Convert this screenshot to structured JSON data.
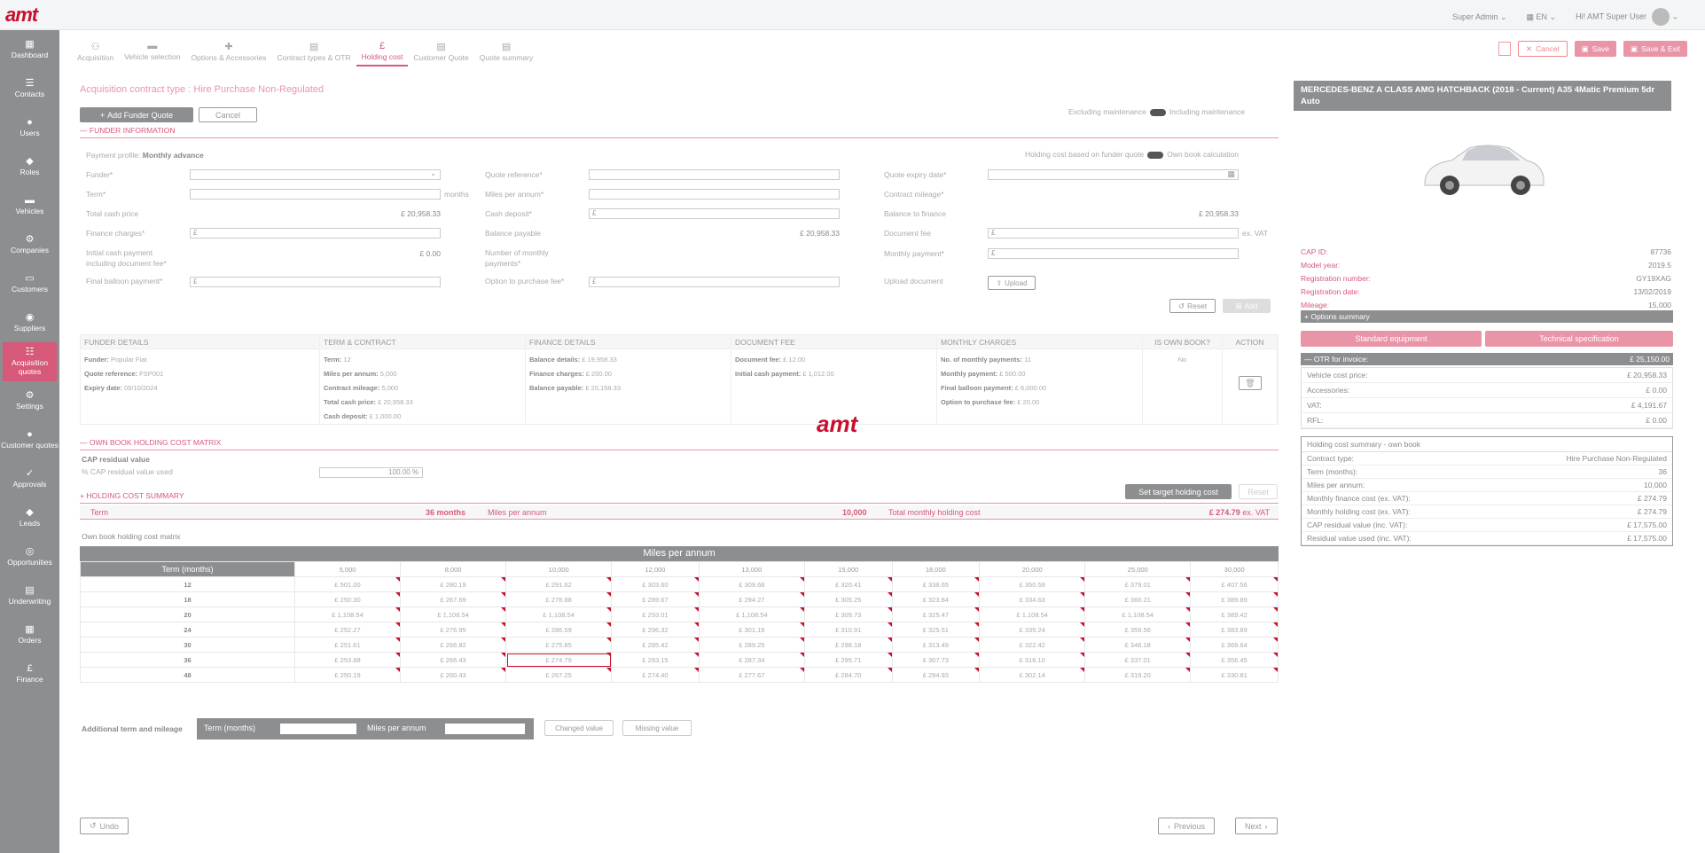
{
  "app": {
    "logo": "amt",
    "role": "Super Admin",
    "lang": "EN",
    "greeting": "Hi! AMT Super User",
    "watermark": "amt"
  },
  "sidebar": [
    {
      "icon": "▦",
      "label": "Dashboard"
    },
    {
      "icon": "☰",
      "label": "Contacts"
    },
    {
      "icon": "●",
      "label": "Users"
    },
    {
      "icon": "◆",
      "label": "Roles"
    },
    {
      "icon": "▬",
      "label": "Vehicles"
    },
    {
      "icon": "⚙",
      "label": "Companies"
    },
    {
      "icon": "▭",
      "label": "Customers"
    },
    {
      "icon": "◉",
      "label": "Suppliers"
    },
    {
      "icon": "☷",
      "label": "Acquisition quotes"
    },
    {
      "icon": "⚙",
      "label": "Settings"
    },
    {
      "icon": "●",
      "label": "Customer quotes"
    },
    {
      "icon": "✓",
      "label": "Approvals"
    },
    {
      "icon": "◆",
      "label": "Leads"
    },
    {
      "icon": "◎",
      "label": "Opportunities"
    },
    {
      "icon": "▤",
      "label": "Underwriting"
    },
    {
      "icon": "▦",
      "label": "Orders"
    },
    {
      "icon": "£",
      "label": "Finance"
    }
  ],
  "tabs": [
    {
      "icon": "⚇",
      "label": "Acquisition"
    },
    {
      "icon": "▬",
      "label": "Vehicle selection"
    },
    {
      "icon": "✚",
      "label": "Options & Accessories"
    },
    {
      "icon": "▤",
      "label": "Contract types & OTR"
    },
    {
      "icon": "£",
      "label": "Holding cost"
    },
    {
      "icon": "▤",
      "label": "Customer Quote"
    },
    {
      "icon": "▤",
      "label": "Quote summary"
    }
  ],
  "actions": {
    "cancel": "Cancel",
    "save": "Save",
    "save_exit": "Save & Exit"
  },
  "form": {
    "contract_type_label": "Acquisition contract type :",
    "contract_type": "Hire Purchase Non-Regulated",
    "add_funder": "Add Funder Quote",
    "cancel": "Cancel",
    "excl": "Excluding maintenance",
    "incl": "Including maintenance",
    "funder_info": "FUNDER INFORMATION",
    "payment_profile_label": "Payment profile:",
    "payment_profile": "Monthly advance",
    "hc_based": "Holding cost based on funder quote",
    "own_book": "Own book calculation",
    "funder": "Funder*",
    "term": "Term*",
    "months": "months",
    "total_cash": "Total cash price",
    "total_cash_val": "£ 20,958.33",
    "finance_charges": "Finance charges*",
    "initial_cash": "Initial cash payment including document fee*",
    "initial_cash_val": "£ 0.00",
    "final_balloon": "Final balloon payment*",
    "quote_ref": "Quote reference*",
    "miles": "Miles per annum*",
    "cash_deposit": "Cash deposit*",
    "balance_payable": "Balance payable",
    "balance_payable_val": "£ 20,958.33",
    "num_monthly": "Number of monthly payments*",
    "option_fee": "Option to purchase fee*",
    "quote_expiry": "Quote expiry date*",
    "contract_mileage": "Contract mileage*",
    "balance_finance": "Balance to finance",
    "balance_finance_val": "£ 20,958.33",
    "document_fee": "Document fee",
    "ex_vat": "ex. VAT",
    "monthly_payment": "Monthly payment*",
    "upload_doc": "Upload document",
    "upload": "Upload",
    "reset": "Reset",
    "add": "Add",
    "pound": "£"
  },
  "funder_table": {
    "headers": [
      "FUNDER DETAILS",
      "TERM & CONTRACT",
      "FINANCE DETAILS",
      "DOCUMENT FEE",
      "MONTHLY CHARGES",
      "IS OWN BOOK?",
      "ACTION"
    ],
    "col1": [
      "Funder: Popular Fiat",
      "Quote reference: FSP001",
      "Expiry date: 05/10/2024"
    ],
    "col2": [
      "Term: 12",
      "Miles per annum: 5,000",
      "Contract mileage: 5,000",
      "Total cash price: £ 20,958.33",
      "Cash deposit: £ 1,000.00"
    ],
    "col3": [
      "Balance details: £ 19,958.33",
      "Finance charges: £ 200.00",
      "Balance payable: £ 20,158.33"
    ],
    "col4": [
      "Document fee: £ 12.00",
      "Initial cash payment: £ 1,012.00"
    ],
    "col5": [
      "No. of monthly payments: 11",
      "Monthly payment: £ 500.00",
      "Final balloon payment: £ 6,000.00",
      "Option to purchase fee: £ 20.00"
    ],
    "own": "No"
  },
  "own_book": {
    "title": "OWN BOOK HOLDING COST MATRIX",
    "cap_label": "CAP residual value",
    "cap_used": "% CAP residual value used",
    "cap_val": "100.00 %"
  },
  "summary": {
    "title": "HOLDING COST SUMMARY",
    "set_target": "Set target holding cost",
    "reset": "Reset",
    "term_label": "Term",
    "term_val": "36 months",
    "miles_label": "Miles per annum",
    "miles_val": "10,000",
    "total_label": "Total monthly holding cost",
    "total_val": "£ 274.79",
    "ex_vat": "ex. VAT"
  },
  "matrix": {
    "title": "Own book holding cost matrix",
    "header": "Miles per annum",
    "term_label": "Term (months)",
    "miles": [
      "5,000",
      "8,000",
      "10,000",
      "12,000",
      "13,000",
      "15,000",
      "18,000",
      "20,000",
      "25,000",
      "30,000"
    ],
    "rows": [
      {
        "term": "12",
        "v": [
          "£ 501.00",
          "£ 280.19",
          "£ 291.62",
          "£ 303.60",
          "£ 309.68",
          "£ 320.41",
          "£ 338.65",
          "£ 350.59",
          "£ 379.01",
          "£ 407.56"
        ]
      },
      {
        "term": "18",
        "v": [
          "£ 250.30",
          "£ 267.69",
          "£ 278.88",
          "£ 289.67",
          "£ 294.27",
          "£ 305.25",
          "£ 323.84",
          "£ 334.63",
          "£ 360.21",
          "£ 389.89"
        ]
      },
      {
        "term": "20",
        "v": [
          "£ 1,108.54",
          "£ 1,108.54",
          "£ 1,108.54",
          "£ 293.01",
          "£ 1,108.54",
          "£ 309.73",
          "£ 325.47",
          "£ 1,108.54",
          "£ 1,108.54",
          "£ 389.42"
        ]
      },
      {
        "term": "24",
        "v": [
          "£ 252.27",
          "£ 276.95",
          "£ 286.59",
          "£ 296.32",
          "£ 301.19",
          "£ 310.91",
          "£ 325.51",
          "£ 335.24",
          "£ 359.56",
          "£ 383.89"
        ]
      },
      {
        "term": "30",
        "v": [
          "£ 251.61",
          "£ 266.82",
          "£ 275.85",
          "£ 285.42",
          "£ 289.25",
          "£ 298.18",
          "£ 313.49",
          "£ 322.42",
          "£ 346.18",
          "£ 369.64"
        ]
      },
      {
        "term": "36",
        "v": [
          "£ 253.88",
          "£ 266.43",
          "£ 274.79",
          "£ 283.15",
          "£ 287.34",
          "£ 295.71",
          "£ 307.73",
          "£ 316.10",
          "£ 337.01",
          "£ 356.45"
        ]
      },
      {
        "term": "48",
        "v": [
          "£ 250.19",
          "£ 260.43",
          "£ 267.25",
          "£ 274.40",
          "£ 277.67",
          "£ 284.70",
          "£ 294.93",
          "£ 302.14",
          "£ 319.20",
          "£ 330.81"
        ]
      }
    ]
  },
  "additional": {
    "label": "Additional term and mileage",
    "term": "Term (months)",
    "miles": "Miles per annum",
    "changed": "Changed value",
    "missing": "Missing value"
  },
  "bottom": {
    "undo": "Undo",
    "previous": "Previous",
    "next": "Next"
  },
  "vehicle": {
    "title": "MERCEDES-BENZ A CLASS AMG HATCHBACK (2018 - Current) A35 4Matic Premium 5dr Auto",
    "specs": [
      {
        "k": "CAP ID:",
        "v": "87736"
      },
      {
        "k": "Model year:",
        "v": "2019.5"
      },
      {
        "k": "Registration number:",
        "v": "GY19XAG"
      },
      {
        "k": "Registration date:",
        "v": "13/02/2019"
      },
      {
        "k": "Mileage:",
        "v": "15,000"
      }
    ],
    "options": "Options summary",
    "std": "Standard equipment",
    "tech": "Technical specification",
    "otr_label": "OTR for invoice:",
    "otr": "£ 25,150.00",
    "otr_items": [
      {
        "k": "Vehicle cost price:",
        "v": "£ 20,958.33"
      },
      {
        "k": "Accessories:",
        "v": "£ 0.00"
      },
      {
        "k": "VAT:",
        "v": "£ 4,191.67"
      },
      {
        "k": "RFL:",
        "v": "£ 0.00"
      }
    ],
    "hc_title": "Holding cost summary - own book",
    "hc_items": [
      {
        "k": "Contract type:",
        "v": "Hire Purchase Non-Regulated"
      },
      {
        "k": "Term (months):",
        "v": "36"
      },
      {
        "k": "Miles per annum:",
        "v": "10,000"
      },
      {
        "k": "Monthly finance cost (ex. VAT):",
        "v": "£ 274.79"
      },
      {
        "k": "Monthly holding cost (ex. VAT):",
        "v": "£ 274.79"
      },
      {
        "k": "CAP residual value (inc. VAT):",
        "v": "£ 17,575.00"
      },
      {
        "k": "Residual value used (inc. VAT):",
        "v": "£ 17,575.00"
      }
    ]
  }
}
